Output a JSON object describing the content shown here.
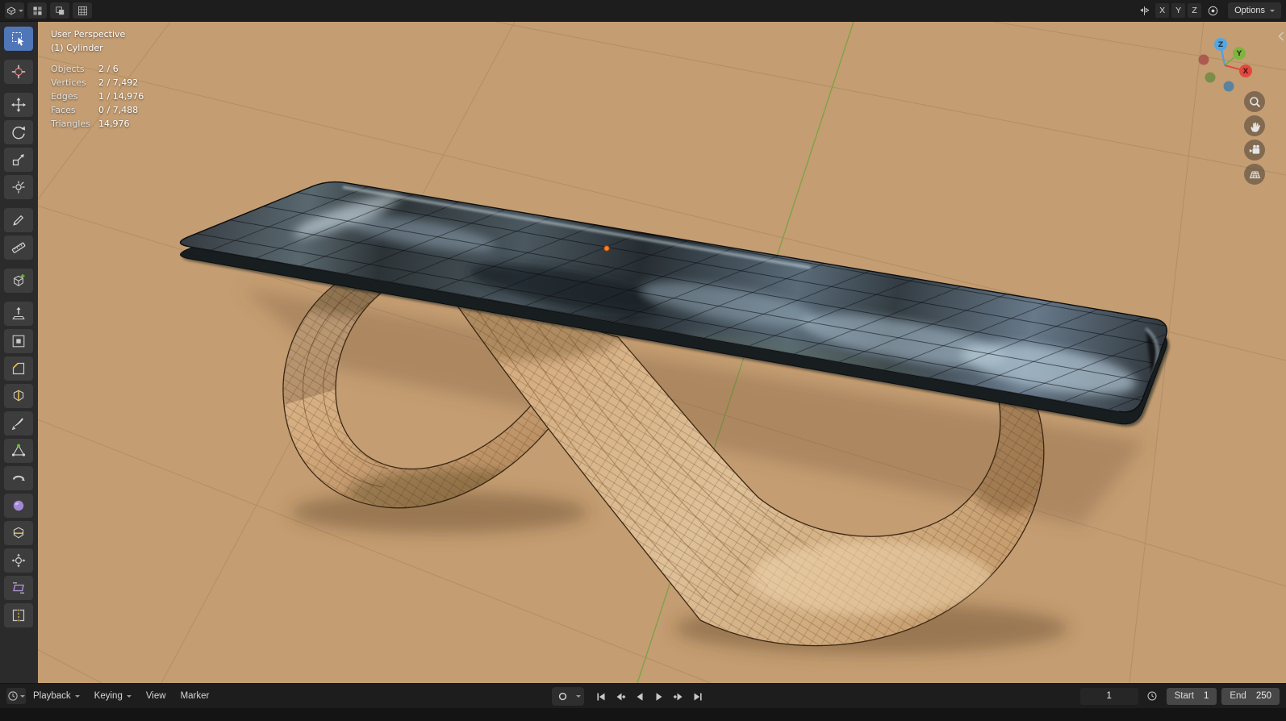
{
  "topbar": {
    "editor_icons": [
      "editor-type-grid",
      "workspace-cube",
      "overlap-squares",
      "grid-3x3"
    ],
    "mirror_icon": "mirror-butterfly",
    "mirror_axes": [
      "X",
      "Y",
      "Z"
    ],
    "snap_icon": "proportional-edit-circles",
    "options_label": "Options"
  },
  "toolbar": {
    "active_tool": "select-box",
    "tools": [
      "select-box",
      "cursor",
      "move",
      "rotate",
      "scale",
      "transform",
      "annotate",
      "measure",
      "add-cube",
      "extrude-region",
      "inset-faces",
      "bevel",
      "loop-cut",
      "knife",
      "poly-build",
      "spin",
      "smooth",
      "edge-slide",
      "shrink-fatten",
      "shear",
      "rip-region"
    ]
  },
  "viewport": {
    "overlay": {
      "view_label": "User Perspective",
      "object_label": "(1) Cylinder",
      "stats": [
        {
          "label": "Objects",
          "value": "2 / 6"
        },
        {
          "label": "Vertices",
          "value": "2 / 7,492"
        },
        {
          "label": "Edges",
          "value": "1 / 14,976"
        },
        {
          "label": "Faces",
          "value": "0 / 7,488"
        },
        {
          "label": "Triangles",
          "value": "14,976"
        }
      ]
    },
    "gizmo_axis_labels": [
      "Z",
      "Y",
      "X"
    ],
    "nav_icons": [
      "zoom",
      "pan-hand",
      "camera-view",
      "toggle-ortho-grid"
    ],
    "scene_objects": [
      "glass-tabletop",
      "wood-left-curl-leg",
      "wood-s-ribbon-leg"
    ],
    "colors": {
      "ground": "#c49d72",
      "grid_line": "#a5875e",
      "axis_y_green": "#74a33e",
      "glass_dark": "#2b3136",
      "glass_reflection": "#9fb4c2",
      "wood_light": "#e0c09a",
      "wood_dark": "#a8815a",
      "accent_blue": "#4f76b8",
      "origin_orange": "#ff8026"
    }
  },
  "timeline": {
    "menus": [
      "Playback",
      "Keying",
      "View",
      "Marker"
    ],
    "record_icon": "record-dot",
    "transport_icons": [
      "jump-to-start",
      "jump-to-prev-keyframe",
      "play-reverse",
      "play",
      "jump-to-next-keyframe",
      "jump-to-end"
    ],
    "current_frame": "1",
    "preview_range_icon": "clock",
    "range": {
      "start_label": "Start",
      "start_value": "1",
      "end_label": "End",
      "end_value": "250"
    }
  }
}
